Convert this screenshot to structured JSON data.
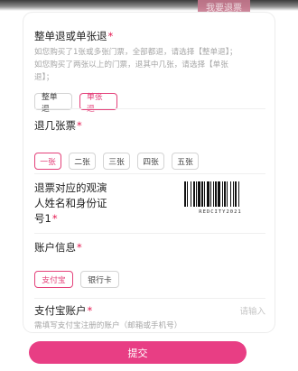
{
  "header": {
    "top_button": "我要退票"
  },
  "refund_type": {
    "title": "整单退或单张退",
    "required_mark": "*",
    "desc_line1": "如您购买了1张或多张门票，全部都退，请选择【整单退】；",
    "desc_line2": "如您购买了两张以上的门票，退其中几张，请选择【单张",
    "desc_line3": "退】；",
    "options": [
      "整单退",
      "单张退"
    ],
    "selected": "单张退"
  },
  "ticket_count": {
    "title": "退几张票",
    "required_mark": "*",
    "options": [
      "一张",
      "二张",
      "三张",
      "四张",
      "五张"
    ],
    "selected": "一张"
  },
  "viewer_info": {
    "title_line1": "退票对应的观演",
    "title_line2": "人姓名和身份证",
    "title_line3": "号1",
    "required_mark": "*",
    "barcode_text": "REDCITY2021"
  },
  "account_info": {
    "title": "账户信息",
    "required_mark": "*",
    "options": [
      "支付宝",
      "银行卡"
    ],
    "selected": "支付宝"
  },
  "alipay_account": {
    "title": "支付宝账户",
    "required_mark": "*",
    "placeholder": "请输入",
    "hint": "需填写支付宝注册的账户（邮箱或手机号）"
  },
  "footer": {
    "submit_label": "提交"
  },
  "colors": {
    "accent": "#e83e84",
    "required": "#e4174f",
    "muted": "#a6a6a6"
  }
}
